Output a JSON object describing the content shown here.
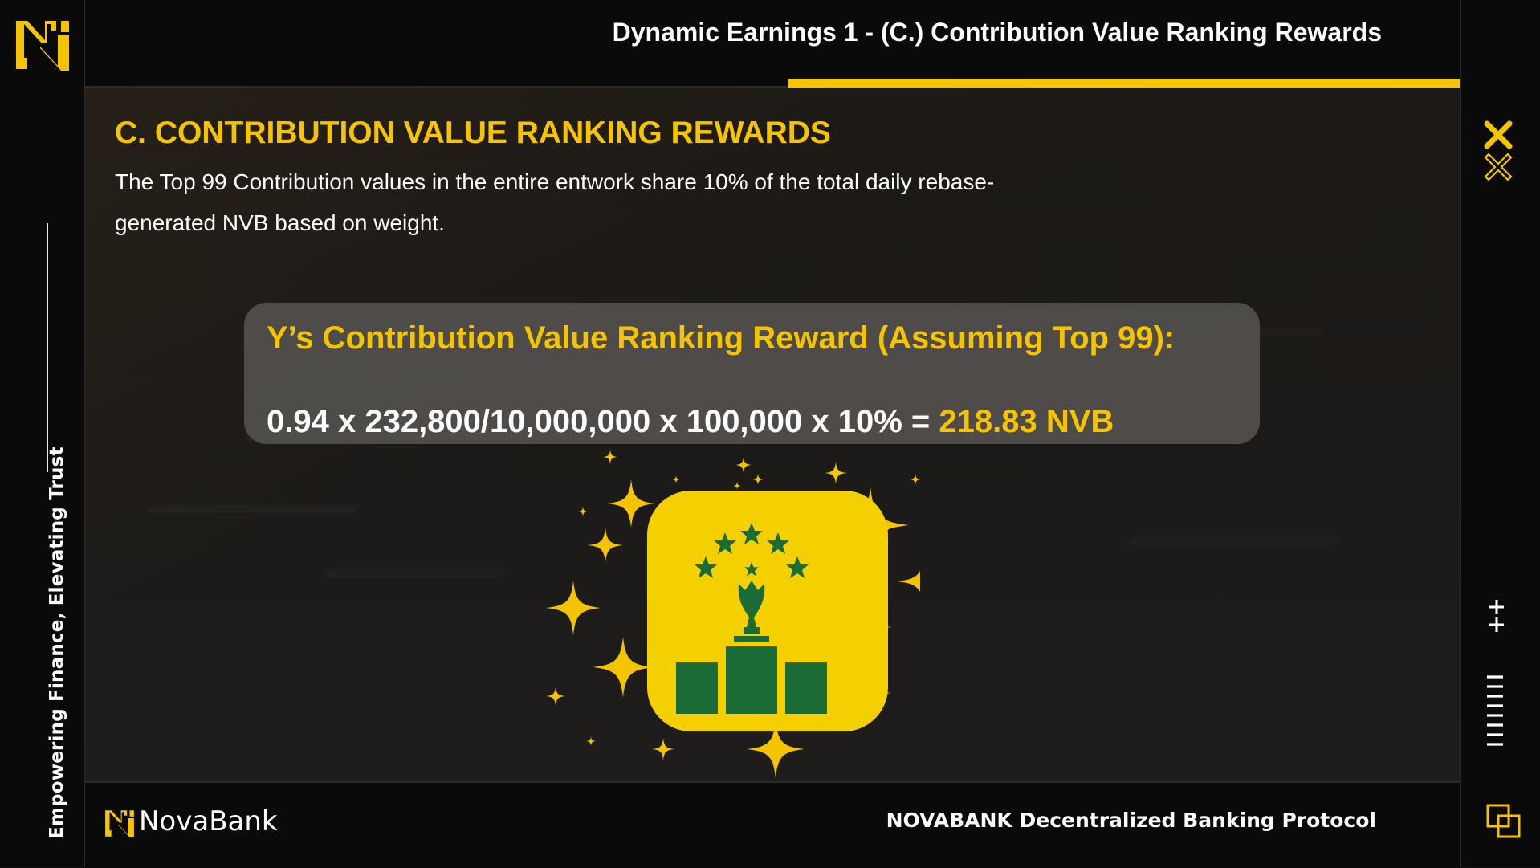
{
  "header": {
    "title": "Dynamic Earnings 1 - (C.) Contribution Value Ranking Rewards"
  },
  "sidebar": {
    "tagline": "Empowering Finance, Elevating Trust"
  },
  "section": {
    "title": "C. CONTRIBUTION VALUE RANKING REWARDS",
    "description": "The Top 99 Contribution values in the entire entwork share 10% of the total daily rebase-generated NVB based on weight."
  },
  "calculation": {
    "title": "Y’s Contribution Value Ranking Reward (Assuming Top 99):",
    "formula": "0.94 x 232,800/10,000,000 x 100,000 x 10% = ",
    "result": "218.83 NVB"
  },
  "footer": {
    "brand": "NovaBank",
    "protocol": "NOVABANK  Decentralized Banking Protocol"
  },
  "colors": {
    "accent": "#f5c400",
    "trophy_green": "#1a6b35",
    "background": "#0d0d0d"
  },
  "icons": [
    "novabank-logo-icon",
    "close-x-icon",
    "outline-x-icon",
    "plus-icon",
    "barcode-lines-icon",
    "overlap-squares-icon",
    "trophy-podium-icon",
    "sparkle-icon"
  ]
}
